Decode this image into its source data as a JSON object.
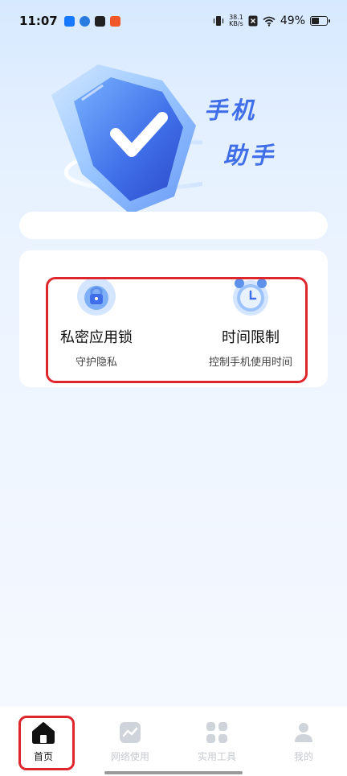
{
  "status_bar": {
    "time": "11:07",
    "net_speed_value": "38.1",
    "net_speed_unit": "KB/s",
    "battery_percent": "49%",
    "battery_level": 0.49
  },
  "hero": {
    "title_line1": "手机",
    "title_line2": "助手",
    "accent_color": "#3f6ee8"
  },
  "features": [
    {
      "title": "私密应用锁",
      "subtitle": "守护隐私",
      "icon": "lock-icon"
    },
    {
      "title": "时间限制",
      "subtitle": "控制手机使用时间",
      "icon": "alarm-clock-icon"
    }
  ],
  "bottom_nav": [
    {
      "label": "首页",
      "icon": "home-icon",
      "active": true
    },
    {
      "label": "网络使用",
      "icon": "chart-icon",
      "active": false
    },
    {
      "label": "实用工具",
      "icon": "grid-icon",
      "active": false
    },
    {
      "label": "我的",
      "icon": "profile-icon",
      "active": false
    }
  ],
  "colors": {
    "highlight": "#e0262d",
    "nav_inactive": "#c6c9cf"
  }
}
